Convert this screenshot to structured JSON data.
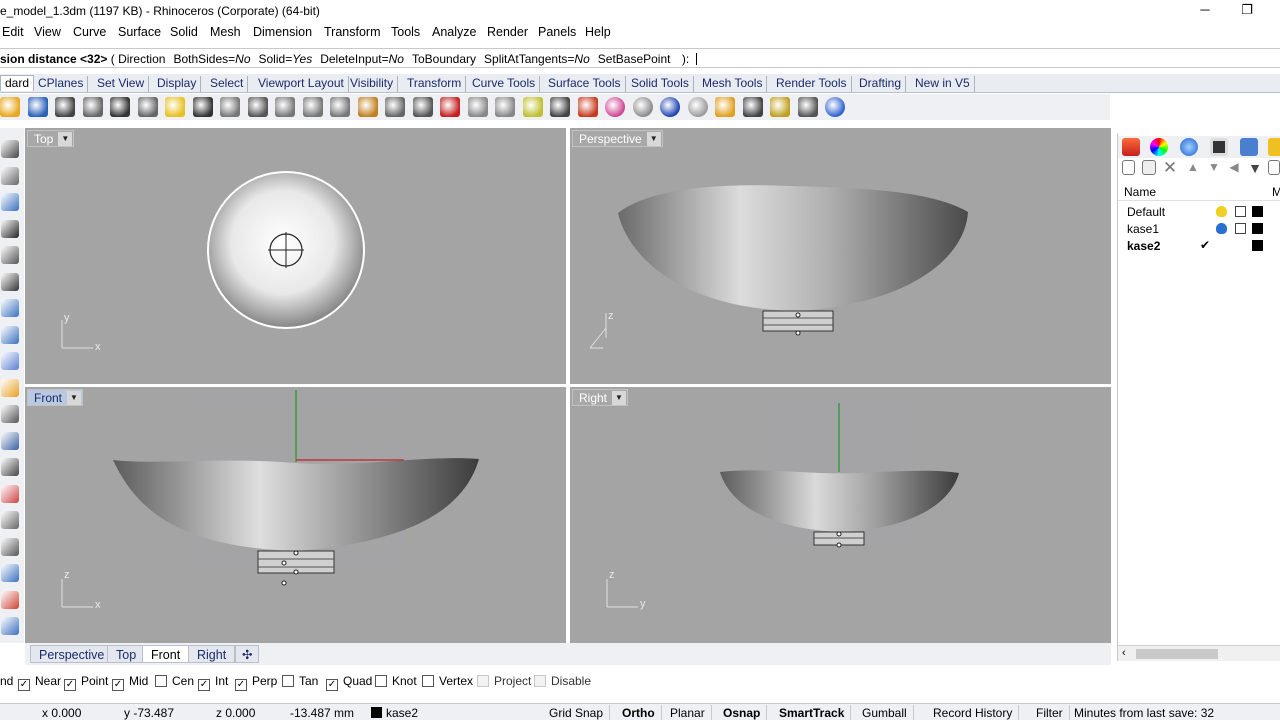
{
  "window": {
    "title": "e_model_1.3dm (1197 KB) - Rhinoceros (Corporate) (64-bit)",
    "minimize_glyph": "─",
    "restore_glyph": "❐"
  },
  "menu": [
    "Edit",
    "View",
    "Curve",
    "Surface",
    "Solid",
    "Mesh",
    "Dimension",
    "Transform",
    "Tools",
    "Analyze",
    "Render",
    "Panels",
    "Help"
  ],
  "command": {
    "prompt_bold": "sion distance <32>",
    "open": "( ",
    "options": [
      {
        "key": "Direction",
        "val": ""
      },
      {
        "key": "BothSides",
        "val": "No"
      },
      {
        "key": "Solid",
        "val": "Yes"
      },
      {
        "key": "DeleteInput",
        "val": "No"
      },
      {
        "key": "ToBoundary",
        "val": ""
      },
      {
        "key": "SplitAtTangents",
        "val": "No"
      },
      {
        "key": "SetBasePoint",
        "val": ""
      }
    ],
    "close": " ):"
  },
  "toolbar_tabs": [
    "dard",
    "CPlanes",
    "Set View",
    "Display",
    "Select",
    "Viewport Layout",
    "Visibility",
    "Transform",
    "Curve Tools",
    "Surface Tools",
    "Solid Tools",
    "Mesh Tools",
    "Render Tools",
    "Drafting",
    "New in V5"
  ],
  "toolbar_icons": [
    "open-icon",
    "save-icon",
    "print-icon",
    "import-icon",
    "cut-icon",
    "copy-icon",
    "paste-icon",
    "undo-icon",
    "pan-icon",
    "rotate-view-icon",
    "zoom-icon",
    "zoom-window-icon",
    "zoom-extents-icon",
    "zoom-selected-icon",
    "rotate-icon",
    "four-viewports-icon",
    "car-render-icon",
    "line-icon",
    "circle-icon",
    "light-icon",
    "lock-icon",
    "layer-icon",
    "color-wheel-icon",
    "shade-icon",
    "render-sphere-icon",
    "ghost-sphere-icon",
    "material-icon",
    "options-icon",
    "gear-icon",
    "dimension-icon",
    "help-icon"
  ],
  "left_tools": [
    "point-icon",
    "polyline-icon",
    "circle-tool-icon",
    "arc-icon",
    "rectangle-icon",
    "curve-icon",
    "surface-icon",
    "solid-icon",
    "mesh-icon",
    "explode-icon",
    "trim-icon",
    "join-icon",
    "move-icon",
    "boolean-icon",
    "array-icon",
    "scale-icon",
    "text-icon",
    "analyze-icon",
    "dimension-tool-icon"
  ],
  "viewports": {
    "top": {
      "label": "Top",
      "axis_x": "x",
      "axis_y": "y"
    },
    "perspective": {
      "label": "Perspective",
      "axis_z": "z"
    },
    "front": {
      "label": "Front",
      "axis_x": "x",
      "axis_z": "z"
    },
    "right": {
      "label": "Right",
      "axis_y": "y",
      "axis_z": "z"
    }
  },
  "viewport_tabs": [
    "Perspective",
    "Top",
    "Front",
    "Right"
  ],
  "viewport_tab_active": "Front",
  "add_tab_glyph": "✣",
  "panel": {
    "column_name": "Name",
    "column_extra": "M",
    "layers": [
      {
        "name": "Default",
        "current": false,
        "bulb": "on",
        "color": "#000000"
      },
      {
        "name": "kase1",
        "current": false,
        "bulb": "on",
        "color": "#000000"
      },
      {
        "name": "kase2",
        "current": true,
        "bulb": "",
        "color": "#000000"
      }
    ],
    "check_glyph": "✔"
  },
  "osnaps": [
    {
      "label": "nd",
      "checked": false,
      "enabled": true,
      "nobox": true
    },
    {
      "label": "Near",
      "checked": true,
      "enabled": true
    },
    {
      "label": "Point",
      "checked": true,
      "enabled": true
    },
    {
      "label": "Mid",
      "checked": true,
      "enabled": true
    },
    {
      "label": "Cen",
      "checked": false,
      "enabled": true
    },
    {
      "label": "Int",
      "checked": true,
      "enabled": true
    },
    {
      "label": "Perp",
      "checked": true,
      "enabled": true
    },
    {
      "label": "Tan",
      "checked": false,
      "enabled": true
    },
    {
      "label": "Quad",
      "checked": true,
      "enabled": true
    },
    {
      "label": "Knot",
      "checked": false,
      "enabled": true
    },
    {
      "label": "Vertex",
      "checked": false,
      "enabled": true
    },
    {
      "label": "Project",
      "checked": false,
      "enabled": false
    },
    {
      "label": "Disable",
      "checked": false,
      "enabled": false
    }
  ],
  "status": {
    "x": "x 0.000",
    "y": "y -73.487",
    "z": "z 0.000",
    "dist": "-13.487 mm",
    "layer": "kase2",
    "grid_snap": "Grid Snap",
    "ortho": "Ortho",
    "planar": "Planar",
    "osnap": "Osnap",
    "smarttrack": "SmartTrack",
    "gumball": "Gumball",
    "record_history": "Record History",
    "filter": "Filter",
    "last_save": "Minutes from last save: 32"
  },
  "colors": {
    "viewport_bg": "#a4a4a4",
    "active_label": "#b8c9e0",
    "gridline": "#9aa2b4",
    "axis_x": "#c42020",
    "axis_y": "#1f9a2a"
  }
}
